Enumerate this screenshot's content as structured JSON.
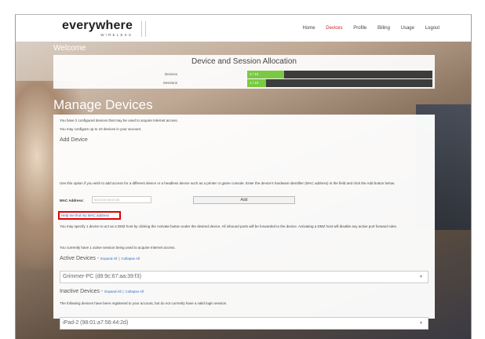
{
  "header": {
    "logo_main": "everywhere",
    "logo_sub": "WIRELESS",
    "nav": [
      "Home",
      "Devices",
      "Profile",
      "Billing",
      "Usage",
      "Logout"
    ],
    "nav_active": "Devices"
  },
  "welcome": "Welcome",
  "allocation": {
    "title": "Device and Session Allocation",
    "rows": [
      {
        "label": "Devices",
        "value_text": "2 / 10",
        "fraction": 0.2
      },
      {
        "label": "Sessions",
        "value_text": "1 / 10",
        "fraction": 0.1
      }
    ]
  },
  "manage": {
    "title": "Manage Devices",
    "intro1": "You have 2 configured devices that may be used to acquire Internet access.",
    "intro2": "You may configure up to 10 devices in your account.",
    "add_heading": "Add Device",
    "add_desc": "Use this option if you wish to add access for a different device or a headless device such as a printer or game console. Enter the device's hardware identifier (MAC address) in the field and click the Add button below.",
    "mac_label": "MAC Address:",
    "mac_placeholder": "00:00:00:00:00:00",
    "add_button": "Add",
    "mac_help": "Help me find my MAC address",
    "dmz_text": "You may specify 1 device to act as a DMZ host by clicking the Activate button under the desired device. All inbound ports will be forwarded to the device. Activating a DMZ host will disable any active port forward rules.",
    "session_text": "You currently have 1 active session being used to acquire Internet access.",
    "active_heading": "Active Devices -",
    "inactive_heading": "Inactive Devices -",
    "expand_all": "Expand All",
    "collapse_all": "Collapse All",
    "separator": "|",
    "inactive_desc": "The following devices have been registered to your account, but do not currently have a valid login session.",
    "active_devices": [
      "Grimmer-PC (d8:9c:67:aa:39:f3)"
    ],
    "inactive_devices": [
      "iPad-2 (98:01:a7:56:44:2d)"
    ]
  }
}
